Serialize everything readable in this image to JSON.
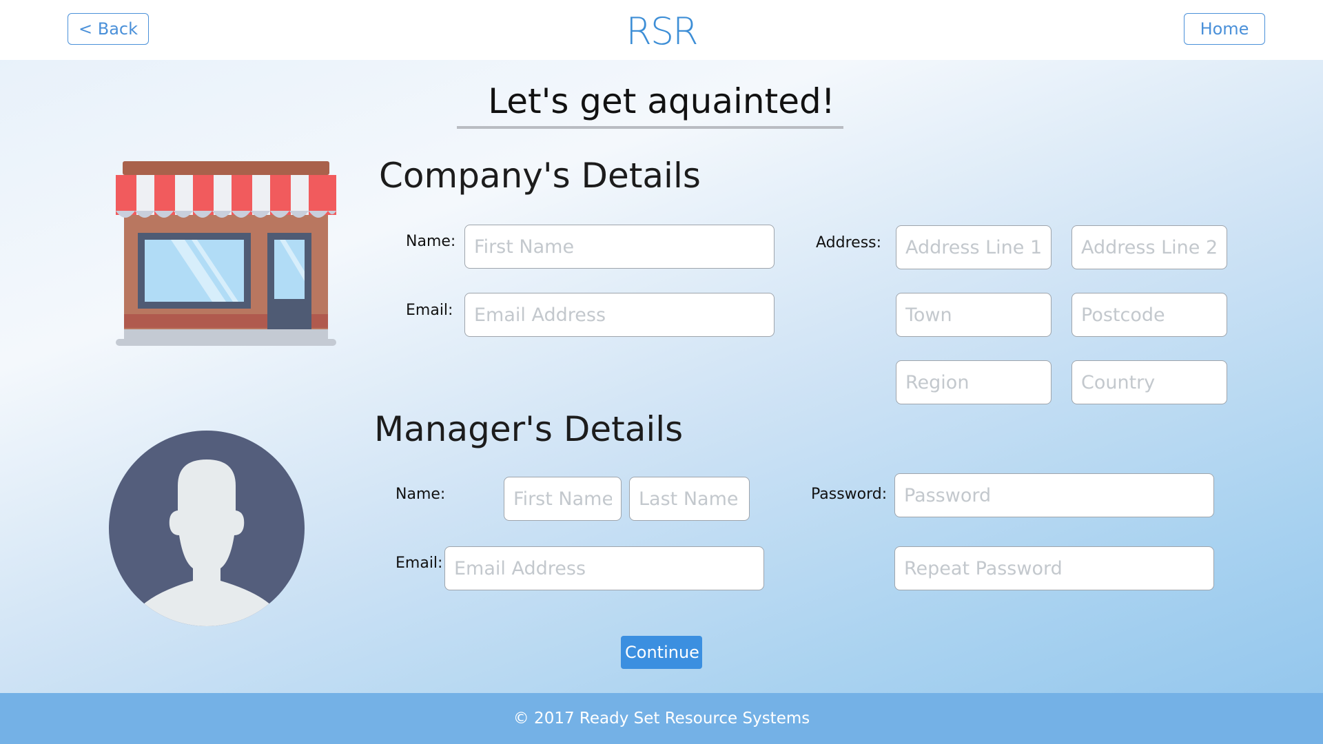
{
  "header": {
    "back_label": "< Back",
    "logo": "RSR",
    "home_label": "Home"
  },
  "page": {
    "title": "Let's get aquainted!"
  },
  "company": {
    "heading": "Company's Details",
    "name_label": "Name:",
    "name_placeholder": "First Name",
    "email_label": "Email:",
    "email_placeholder": "Email Address",
    "address_label": "Address:",
    "address_line1_placeholder": "Address Line 1",
    "address_line2_placeholder": "Address Line 2",
    "town_placeholder": "Town",
    "postcode_placeholder": "Postcode",
    "region_placeholder": "Region",
    "country_placeholder": "Country"
  },
  "manager": {
    "heading": "Manager's Details",
    "name_label": "Name:",
    "first_name_placeholder": "First Name",
    "last_name_placeholder": "Last Name",
    "email_label": "Email:",
    "email_placeholder": "Email Address",
    "password_label": "Password:",
    "password_placeholder": "Password",
    "repeat_password_placeholder": "Repeat Password"
  },
  "actions": {
    "continue_label": "Continue"
  },
  "footer": {
    "copyright": "© 2017 Ready Set Resource Systems"
  },
  "colors": {
    "accent": "#3b8fe0",
    "logo": "#3d8ed6",
    "footer": "#74b1e6"
  },
  "icons": {
    "company": "storefront-icon",
    "manager": "user-avatar-icon"
  }
}
